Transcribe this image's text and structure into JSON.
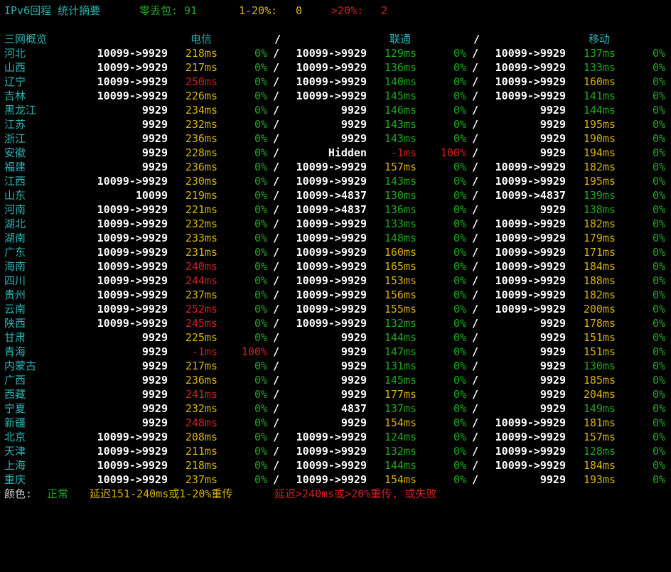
{
  "summary": {
    "title": "IPv6回程 统计摘要",
    "zero_loss_label": "零丢包: 91",
    "low_loss_label": "1-20%:",
    "low_loss_value": "0",
    "high_loss_label": ">20%:",
    "high_loss_value": "2"
  },
  "header": {
    "overview": "三网概览",
    "telecom": "电信",
    "unicom": "联通",
    "mobile": "移动",
    "sep": "/"
  },
  "legend": {
    "prefix": "颜色:",
    "normal": "正常",
    "warn": "延迟151-240ms或1-20%重传",
    "bad": "延迟>240ms或>20%重传, 或失败"
  },
  "rows": [
    {
      "prov": "河北",
      "t": [
        "10099->9929",
        "218ms",
        "0%"
      ],
      "u": [
        "10099->9929",
        "129ms",
        "0%"
      ],
      "m": [
        "10099->9929",
        "137ms",
        "0%"
      ],
      "tc": [
        "y",
        "g"
      ],
      "uc": [
        "g",
        "g"
      ],
      "mc": [
        "g",
        "g"
      ]
    },
    {
      "prov": "山西",
      "t": [
        "10099->9929",
        "217ms",
        "0%"
      ],
      "u": [
        "10099->9929",
        "136ms",
        "0%"
      ],
      "m": [
        "10099->9929",
        "133ms",
        "0%"
      ],
      "tc": [
        "y",
        "g"
      ],
      "uc": [
        "g",
        "g"
      ],
      "mc": [
        "g",
        "g"
      ]
    },
    {
      "prov": "辽宁",
      "t": [
        "10099->9929",
        "250ms",
        "0%"
      ],
      "u": [
        "10099->9929",
        "140ms",
        "0%"
      ],
      "m": [
        "10099->9929",
        "160ms",
        "0%"
      ],
      "tc": [
        "r",
        "g"
      ],
      "uc": [
        "g",
        "g"
      ],
      "mc": [
        "y",
        "g"
      ]
    },
    {
      "prov": "吉林",
      "t": [
        "10099->9929",
        "226ms",
        "0%"
      ],
      "u": [
        "10099->9929",
        "145ms",
        "0%"
      ],
      "m": [
        "10099->9929",
        "141ms",
        "0%"
      ],
      "tc": [
        "y",
        "g"
      ],
      "uc": [
        "g",
        "g"
      ],
      "mc": [
        "g",
        "g"
      ]
    },
    {
      "prov": "黑龙江",
      "t": [
        "9929",
        "234ms",
        "0%"
      ],
      "u": [
        "9929",
        "146ms",
        "0%"
      ],
      "m": [
        "9929",
        "144ms",
        "0%"
      ],
      "tc": [
        "y",
        "g"
      ],
      "uc": [
        "g",
        "g"
      ],
      "mc": [
        "g",
        "g"
      ]
    },
    {
      "prov": "江苏",
      "t": [
        "9929",
        "232ms",
        "0%"
      ],
      "u": [
        "9929",
        "143ms",
        "0%"
      ],
      "m": [
        "9929",
        "195ms",
        "0%"
      ],
      "tc": [
        "y",
        "g"
      ],
      "uc": [
        "g",
        "g"
      ],
      "mc": [
        "y",
        "g"
      ]
    },
    {
      "prov": "浙江",
      "t": [
        "9929",
        "236ms",
        "0%"
      ],
      "u": [
        "9929",
        "143ms",
        "0%"
      ],
      "m": [
        "9929",
        "190ms",
        "0%"
      ],
      "tc": [
        "y",
        "g"
      ],
      "uc": [
        "g",
        "g"
      ],
      "mc": [
        "y",
        "g"
      ]
    },
    {
      "prov": "安徽",
      "t": [
        "9929",
        "228ms",
        "0%"
      ],
      "u": [
        "Hidden",
        "-1ms",
        "100%"
      ],
      "m": [
        "9929",
        "194ms",
        "0%"
      ],
      "tc": [
        "y",
        "g"
      ],
      "uc": [
        "r",
        "r"
      ],
      "mc": [
        "y",
        "g"
      ]
    },
    {
      "prov": "福建",
      "t": [
        "9929",
        "236ms",
        "0%"
      ],
      "u": [
        "10099->9929",
        "157ms",
        "0%"
      ],
      "m": [
        "10099->9929",
        "182ms",
        "0%"
      ],
      "tc": [
        "y",
        "g"
      ],
      "uc": [
        "y",
        "g"
      ],
      "mc": [
        "y",
        "g"
      ]
    },
    {
      "prov": "江西",
      "t": [
        "10099->9929",
        "230ms",
        "0%"
      ],
      "u": [
        "10099->9929",
        "143ms",
        "0%"
      ],
      "m": [
        "10099->9929",
        "195ms",
        "0%"
      ],
      "tc": [
        "y",
        "g"
      ],
      "uc": [
        "g",
        "g"
      ],
      "mc": [
        "y",
        "g"
      ]
    },
    {
      "prov": "山东",
      "t": [
        "10099",
        "219ms",
        "0%"
      ],
      "u": [
        "10099->4837",
        "130ms",
        "0%"
      ],
      "m": [
        "10099->4837",
        "139ms",
        "0%"
      ],
      "tc": [
        "y",
        "g"
      ],
      "uc": [
        "g",
        "g"
      ],
      "mc": [
        "g",
        "g"
      ]
    },
    {
      "prov": "河南",
      "t": [
        "10099->9929",
        "221ms",
        "0%"
      ],
      "u": [
        "10099->4837",
        "136ms",
        "0%"
      ],
      "m": [
        "9929",
        "138ms",
        "0%"
      ],
      "tc": [
        "y",
        "g"
      ],
      "uc": [
        "g",
        "g"
      ],
      "mc": [
        "g",
        "g"
      ]
    },
    {
      "prov": "湖北",
      "t": [
        "10099->9929",
        "232ms",
        "0%"
      ],
      "u": [
        "10099->9929",
        "133ms",
        "0%"
      ],
      "m": [
        "10099->9929",
        "182ms",
        "0%"
      ],
      "tc": [
        "y",
        "g"
      ],
      "uc": [
        "g",
        "g"
      ],
      "mc": [
        "y",
        "g"
      ]
    },
    {
      "prov": "湖南",
      "t": [
        "10099->9929",
        "233ms",
        "0%"
      ],
      "u": [
        "10099->9929",
        "148ms",
        "0%"
      ],
      "m": [
        "10099->9929",
        "179ms",
        "0%"
      ],
      "tc": [
        "y",
        "g"
      ],
      "uc": [
        "g",
        "g"
      ],
      "mc": [
        "y",
        "g"
      ]
    },
    {
      "prov": "广东",
      "t": [
        "10099->9929",
        "231ms",
        "0%"
      ],
      "u": [
        "10099->9929",
        "160ms",
        "0%"
      ],
      "m": [
        "10099->9929",
        "171ms",
        "0%"
      ],
      "tc": [
        "y",
        "g"
      ],
      "uc": [
        "y",
        "g"
      ],
      "mc": [
        "y",
        "g"
      ]
    },
    {
      "prov": "海南",
      "t": [
        "10099->9929",
        "240ms",
        "0%"
      ],
      "u": [
        "10099->9929",
        "165ms",
        "0%"
      ],
      "m": [
        "10099->9929",
        "184ms",
        "0%"
      ],
      "tc": [
        "r",
        "g"
      ],
      "uc": [
        "y",
        "g"
      ],
      "mc": [
        "y",
        "g"
      ]
    },
    {
      "prov": "四川",
      "t": [
        "10099->9929",
        "244ms",
        "0%"
      ],
      "u": [
        "10099->9929",
        "153ms",
        "0%"
      ],
      "m": [
        "10099->9929",
        "188ms",
        "0%"
      ],
      "tc": [
        "r",
        "g"
      ],
      "uc": [
        "y",
        "g"
      ],
      "mc": [
        "y",
        "g"
      ]
    },
    {
      "prov": "贵州",
      "t": [
        "10099->9929",
        "237ms",
        "0%"
      ],
      "u": [
        "10099->9929",
        "156ms",
        "0%"
      ],
      "m": [
        "10099->9929",
        "182ms",
        "0%"
      ],
      "tc": [
        "y",
        "g"
      ],
      "uc": [
        "y",
        "g"
      ],
      "mc": [
        "y",
        "g"
      ]
    },
    {
      "prov": "云南",
      "t": [
        "10099->9929",
        "252ms",
        "0%"
      ],
      "u": [
        "10099->9929",
        "155ms",
        "0%"
      ],
      "m": [
        "10099->9929",
        "200ms",
        "0%"
      ],
      "tc": [
        "r",
        "g"
      ],
      "uc": [
        "y",
        "g"
      ],
      "mc": [
        "y",
        "g"
      ]
    },
    {
      "prov": "陕西",
      "t": [
        "10099->9929",
        "245ms",
        "0%"
      ],
      "u": [
        "10099->9929",
        "132ms",
        "0%"
      ],
      "m": [
        "9929",
        "178ms",
        "0%"
      ],
      "tc": [
        "r",
        "g"
      ],
      "uc": [
        "g",
        "g"
      ],
      "mc": [
        "y",
        "g"
      ]
    },
    {
      "prov": "甘肃",
      "t": [
        "9929",
        "225ms",
        "0%"
      ],
      "u": [
        "9929",
        "144ms",
        "0%"
      ],
      "m": [
        "9929",
        "151ms",
        "0%"
      ],
      "tc": [
        "y",
        "g"
      ],
      "uc": [
        "g",
        "g"
      ],
      "mc": [
        "y",
        "g"
      ]
    },
    {
      "prov": "青海",
      "t": [
        "9929",
        "-1ms",
        "100%"
      ],
      "u": [
        "9929",
        "147ms",
        "0%"
      ],
      "m": [
        "9929",
        "151ms",
        "0%"
      ],
      "tc": [
        "r",
        "r"
      ],
      "uc": [
        "g",
        "g"
      ],
      "mc": [
        "y",
        "g"
      ]
    },
    {
      "prov": "内蒙古",
      "t": [
        "9929",
        "217ms",
        "0%"
      ],
      "u": [
        "9929",
        "131ms",
        "0%"
      ],
      "m": [
        "9929",
        "130ms",
        "0%"
      ],
      "tc": [
        "y",
        "g"
      ],
      "uc": [
        "g",
        "g"
      ],
      "mc": [
        "g",
        "g"
      ]
    },
    {
      "prov": "广西",
      "t": [
        "9929",
        "236ms",
        "0%"
      ],
      "u": [
        "9929",
        "145ms",
        "0%"
      ],
      "m": [
        "9929",
        "185ms",
        "0%"
      ],
      "tc": [
        "y",
        "g"
      ],
      "uc": [
        "g",
        "g"
      ],
      "mc": [
        "y",
        "g"
      ]
    },
    {
      "prov": "西藏",
      "t": [
        "9929",
        "241ms",
        "0%"
      ],
      "u": [
        "9929",
        "177ms",
        "0%"
      ],
      "m": [
        "9929",
        "204ms",
        "0%"
      ],
      "tc": [
        "r",
        "g"
      ],
      "uc": [
        "y",
        "g"
      ],
      "mc": [
        "y",
        "g"
      ]
    },
    {
      "prov": "宁夏",
      "t": [
        "9929",
        "232ms",
        "0%"
      ],
      "u": [
        "4837",
        "137ms",
        "0%"
      ],
      "m": [
        "9929",
        "149ms",
        "0%"
      ],
      "tc": [
        "y",
        "g"
      ],
      "uc": [
        "g",
        "g"
      ],
      "mc": [
        "g",
        "g"
      ]
    },
    {
      "prov": "新疆",
      "t": [
        "9929",
        "248ms",
        "0%"
      ],
      "u": [
        "9929",
        "154ms",
        "0%"
      ],
      "m": [
        "10099->9929",
        "181ms",
        "0%"
      ],
      "tc": [
        "r",
        "g"
      ],
      "uc": [
        "y",
        "g"
      ],
      "mc": [
        "y",
        "g"
      ]
    },
    {
      "prov": "北京",
      "t": [
        "10099->9929",
        "208ms",
        "0%"
      ],
      "u": [
        "10099->9929",
        "124ms",
        "0%"
      ],
      "m": [
        "10099->9929",
        "157ms",
        "0%"
      ],
      "tc": [
        "y",
        "g"
      ],
      "uc": [
        "g",
        "g"
      ],
      "mc": [
        "y",
        "g"
      ]
    },
    {
      "prov": "天津",
      "t": [
        "10099->9929",
        "211ms",
        "0%"
      ],
      "u": [
        "10099->9929",
        "132ms",
        "0%"
      ],
      "m": [
        "10099->9929",
        "128ms",
        "0%"
      ],
      "tc": [
        "y",
        "g"
      ],
      "uc": [
        "g",
        "g"
      ],
      "mc": [
        "g",
        "g"
      ]
    },
    {
      "prov": "上海",
      "t": [
        "10099->9929",
        "218ms",
        "0%"
      ],
      "u": [
        "10099->9929",
        "144ms",
        "0%"
      ],
      "m": [
        "10099->9929",
        "184ms",
        "0%"
      ],
      "tc": [
        "y",
        "g"
      ],
      "uc": [
        "g",
        "g"
      ],
      "mc": [
        "y",
        "g"
      ]
    },
    {
      "prov": "重庆",
      "t": [
        "10099->9929",
        "237ms",
        "0%"
      ],
      "u": [
        "10099->9929",
        "154ms",
        "0%"
      ],
      "m": [
        "9929",
        "193ms",
        "0%"
      ],
      "tc": [
        "y",
        "g"
      ],
      "uc": [
        "y",
        "g"
      ],
      "mc": [
        "y",
        "g"
      ]
    }
  ]
}
